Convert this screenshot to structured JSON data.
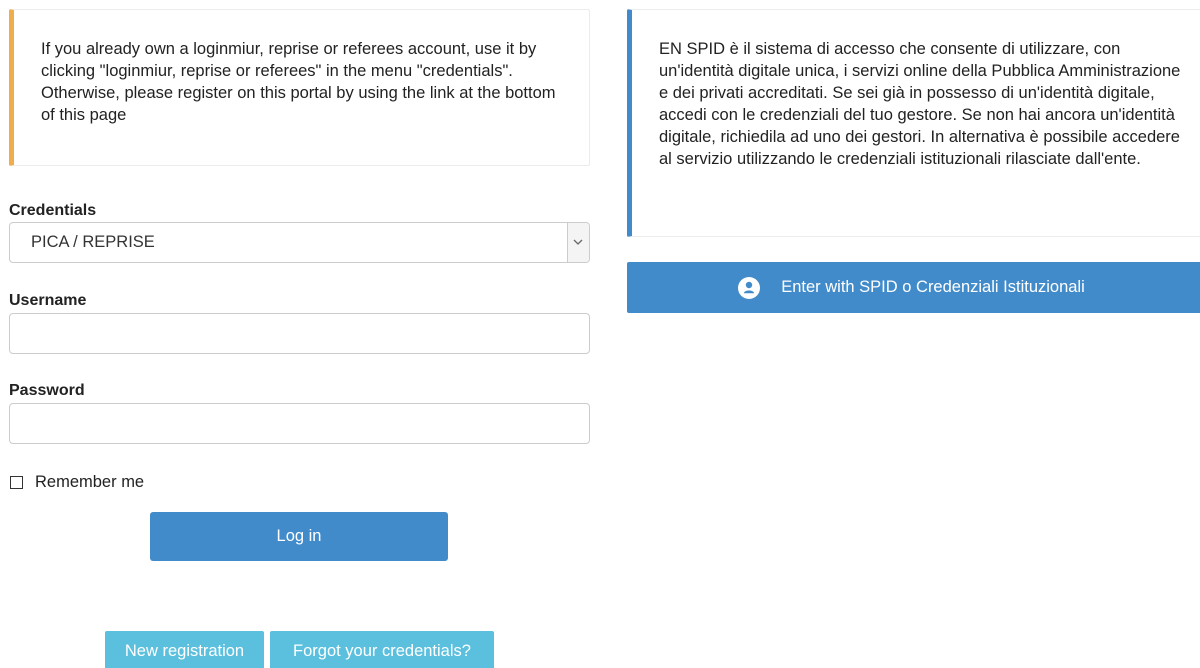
{
  "left_notice": {
    "text": "If you already own a loginmiur, reprise or referees account, use it by clicking \"loginmiur, reprise or referees\" in the menu \"credentials\". Otherwise, please register on this portal by using the link at the bottom of this page"
  },
  "credentials": {
    "label": "Credentials",
    "selected": "PICA / REPRISE"
  },
  "username": {
    "label": "Username",
    "value": ""
  },
  "password": {
    "label": "Password",
    "value": ""
  },
  "remember": {
    "label": "Remember me",
    "checked": false
  },
  "buttons": {
    "login": "Log in",
    "new_registration": "New registration",
    "forgot": "Forgot your credentials?",
    "spid": "Enter with SPID o Credenziali Istituzionali"
  },
  "right_notice": {
    "text": "EN SPID è il sistema di accesso che consente di utilizzare, con un'identità digitale unica, i servizi online della Pubblica Amministrazione e dei privati accreditati. Se sei già in possesso di un'identità digitale, accedi con le credenziali del tuo gestore. Se non hai ancora un'identità digitale, richiedila ad uno dei gestori. In alternativa è possibile accedere al servizio utilizzando le credenziali istituzionali rilasciate dall'ente."
  },
  "colors": {
    "primary": "#428bca",
    "info": "#5bc0de",
    "warning": "#f0ad4e"
  },
  "icons": {
    "select_arrow": "chevron-down-icon",
    "spid": "user-circle-icon"
  }
}
